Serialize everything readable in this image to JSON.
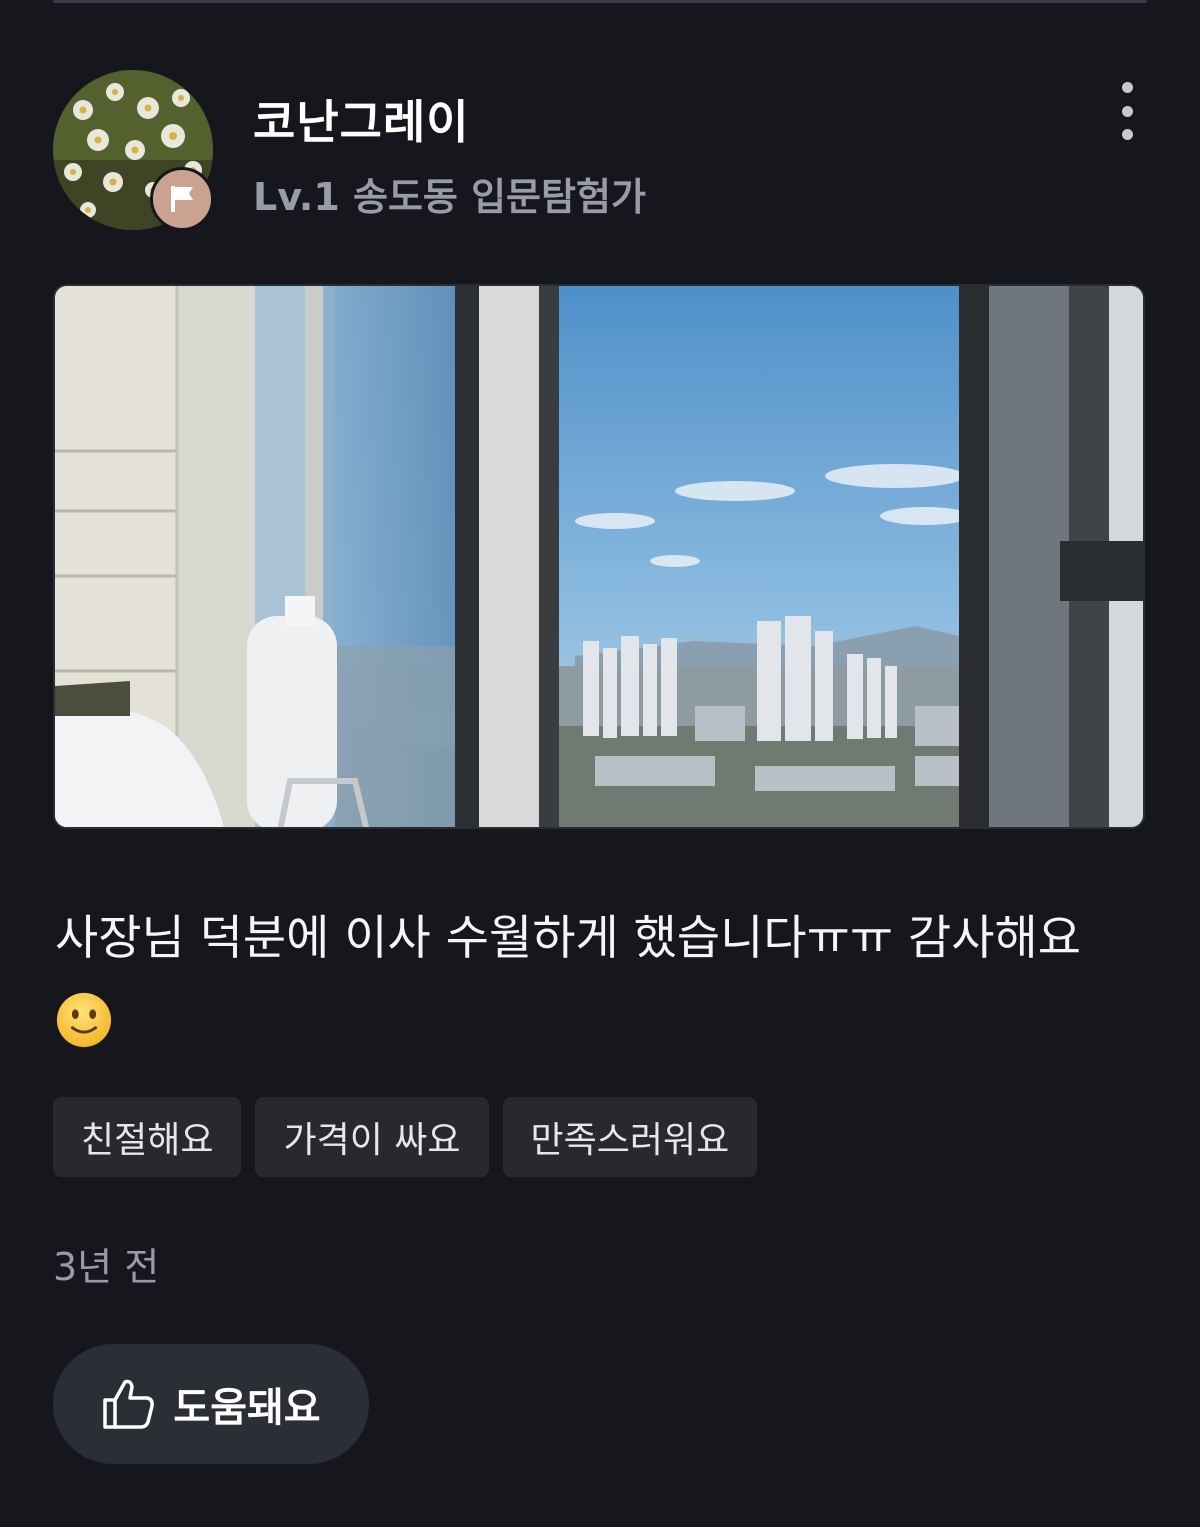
{
  "author": {
    "name": "코난그레이",
    "level": "Lv.1 송도동 입문탐험가"
  },
  "icons": {
    "more": "more-vertical-icon",
    "badge": "flag-icon",
    "helpful": "thumbs-up-icon",
    "emoji": "slightly-smiling-face-emoji"
  },
  "review": {
    "text": "사장님 덕분에 이사 수월하게 했습니다ㅠㅠ 감사해요"
  },
  "tags": [
    {
      "label": "친절해요"
    },
    {
      "label": "가격이 싸요"
    },
    {
      "label": "만족스러워요"
    }
  ],
  "meta": {
    "time": "3년 전"
  },
  "actions": {
    "helpful_label": "도움돼요"
  },
  "colors": {
    "background": "#16171c",
    "tag_bg": "#27292f",
    "badge": "#c9a390",
    "muted_text": "#9a9ca3"
  }
}
